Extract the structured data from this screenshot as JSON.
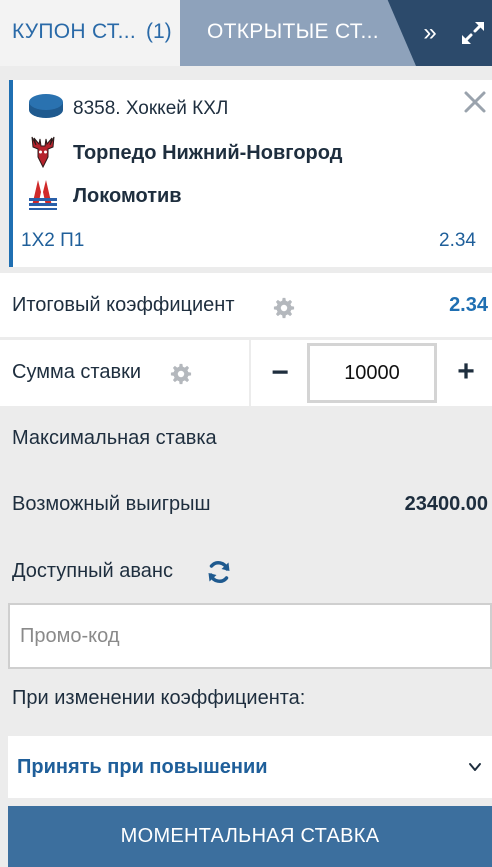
{
  "tabs": {
    "coupon_label": "КУПОН СТ...",
    "coupon_count": "(1)",
    "open_label": "ОТКРЫТЫЕ СТ...",
    "more_glyph": "»"
  },
  "event": {
    "league": "8358. Хоккей КХЛ",
    "team1": "Торпедо Нижний-Новгород",
    "team2": "Локомотив",
    "market": "1X2 П1",
    "odds": "2.34"
  },
  "summary": {
    "total_odds_label": "Итоговый коэффициент",
    "total_odds_value": "2.34",
    "stake_label": "Сумма ставки",
    "stake_value": "10000",
    "stake_minus": "−",
    "stake_plus": "+",
    "max_stake_label": "Максимальная ставка",
    "possible_win_label": "Возможный выигрыш",
    "possible_win_value": "23400.00",
    "advance_label": "Доступный аванс"
  },
  "promo": {
    "placeholder": "Промо-код"
  },
  "odds_change": {
    "label": "При изменении коэффициента:",
    "selected": "Принять при повышении"
  },
  "submit_label": "МОМЕНТАЛЬНАЯ СТАВКА",
  "icons": {
    "league": "hockey-puck-icon",
    "close": "close-icon",
    "gear": "gear-icon",
    "refresh": "refresh-icon",
    "chevron": "chevron-down-icon",
    "expand": "expand-icon",
    "more": "double-chevron-right-icon"
  },
  "colors": {
    "brand_dark": "#2c4a6b",
    "accent_blue": "#1f6fb2",
    "submit_bg": "#3c6f9e",
    "tab_inactive": "#8ea2bb"
  }
}
